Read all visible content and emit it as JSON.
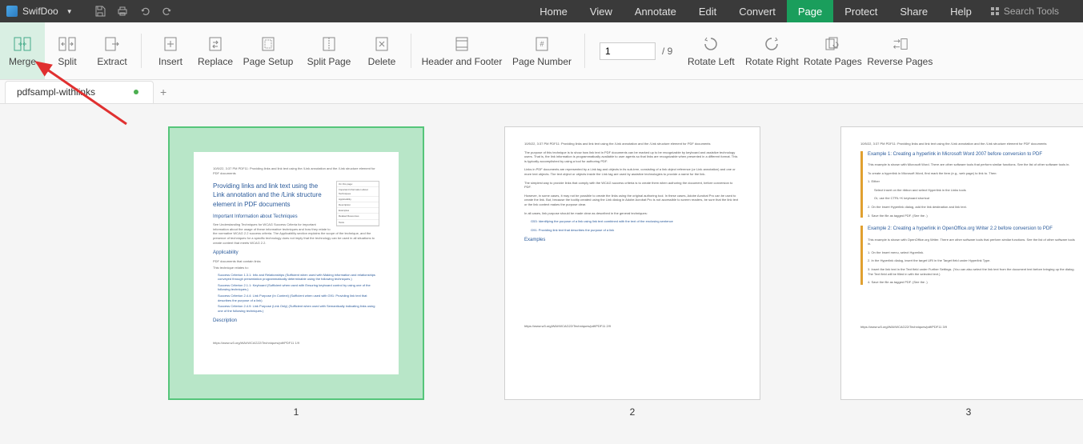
{
  "app": {
    "name": "SwifDoo"
  },
  "menu": {
    "items": [
      "Home",
      "View",
      "Annotate",
      "Edit",
      "Convert",
      "Page",
      "Protect",
      "Share",
      "Help"
    ],
    "active": "Page",
    "search_placeholder": "Search Tools"
  },
  "toolbar": {
    "merge": "Merge",
    "split": "Split",
    "extract": "Extract",
    "insert": "Insert",
    "replace": "Replace",
    "page_setup": "Page Setup",
    "split_page": "Split Page",
    "delete": "Delete",
    "header_footer": "Header and Footer",
    "page_number": "Page Number",
    "rotate_left": "Rotate Left",
    "rotate_right": "Rotate Right",
    "rotate_pages": "Rotate Pages",
    "reverse_pages": "Reverse Pages",
    "page_input": "1",
    "page_total": "/ 9"
  },
  "tabs": {
    "tab1": "pdfsampl-withlinks"
  },
  "thumbs": {
    "p1": "1",
    "p2": "2",
    "p3": "3"
  },
  "doc1": {
    "top": "10/5/22, 3:37 PM            PDF11: Providing links and link text using the /Link annotation and the /Link structure element for PDF documents",
    "title": "Providing links and link text using the Link annotation and the /Link structure element in PDF documents",
    "side1": "On this page:",
    "side2": "Important Information about Techniques",
    "side3": "Applicability",
    "side4": "Description",
    "side5": "Examples",
    "side6": "Related Resources",
    "side7": "Tests",
    "h1": "Important Information about Techniques",
    "p1": "See Understanding Techniques for WCAG Success Criteria for important information about the usage of these informative techniques and how they relate to the normative WCAG 2.2 success criteria. The Applicability section explains the scope of the technique, and the presence of techniques for a specific technology does not imply that the technology can be used in all situations to create content that meets WCAG 2.2.",
    "h2": "Applicability",
    "p2": "PDF documents that contain links",
    "p3": "This technique relates to:",
    "li1": "Success Criterion 1.3.1: Info and Relationships (Sufficient when used with Making information and relationships conveyed through presentation programmatically determinable using the following techniques.)",
    "li2": "Success Criterion 2.1.1: Keyboard (Sufficient when used with Ensuring keyboard control by using one of the following techniques.)",
    "li3": "Success Criterion 2.4.4: Link Purpose (In Context) (Sufficient when used with G91: Providing link text that describes the purpose of a link)",
    "li4": "Success Criterion 2.4.9: Link Purpose (Link Only) (Sufficient when used with Semantically indicating links using one of the following techniques.)",
    "h3": "Description",
    "foot": "https://www.w3.org/WAI/WCAG22/Techniques/pdf/PDF11                                                                                                                                       1/9"
  },
  "doc2": {
    "top": "10/5/22, 3:37 PM            PDF11: Providing links and link text using the /Link annotation and the /Link structure element for PDF documents",
    "p1": "The purpose of this technique is to show how link text in PDF documents can be marked up to be recognizable by keyboard and assistive technology users. That is, the link information is programmatically available to user agents so that links are recognizable when presented in a different format. This is typically accomplished by using a tool for authoring PDF.",
    "p2": "Links in PDF documents are represented by a Link tag and objects in its sub-tree, consisting of a link object reference (or Link annotation) and one or more text objects. The text object or objects inside the Link tag are used by assistive technologies to provide a name for the link.",
    "p3": "The simplest way to provide links that comply with the WCAG success criteria is to create them when authoring the document, before conversion to PDF.",
    "p4": "However, in some cases, it may not be possible to create the links using the original authoring tool. In these cases, Adobe Acrobat Pro can be used to create the link. But, because the tooltip created using the Link dialog in Adobe Acrobat Pro is not accessible to screen readers, be sure that the link text or the link context makes the purpose clear.",
    "p5": "In all cases, link purpose should be made clear as described in the general techniques:",
    "li1": "G53: Identifying the purpose of a link using link text combined with the text of the enclosing sentence",
    "li2": "G91: Providing link text that describes the purpose of a link",
    "h1": "Examples",
    "foot": "https://www.w3.org/WAI/WCAG22/Techniques/pdf/PDF11                                                                                                                                       2/9"
  },
  "doc3": {
    "top": "10/5/22, 3:37 PM            PDF11: Providing links and link text using the /Link annotation and the /Link structure element for PDF documents",
    "h1": "Example 1: Creating a hyperlink in Microsoft Word 2007 before conversion to PDF",
    "p1": "This example is shown with Microsoft Word. There are other software tools that perform similar functions. See the list of other software tools in.",
    "p2": "To create a hyperlink in Microsoft Word, first mark the item (e.g., web page) to link to. Then:",
    "li1": "1. Either",
    "li1a": "Select Insert on the ribbon and select Hyperlink in the Links tools",
    "li1b": "Or, use the CTRL+K keyboard shortcut",
    "li2": "2. On the Insert Hyperlink dialog, add the link destination and link text.",
    "li3": "3. Save the file as tagged PDF. (See the .)",
    "h2": "Example 2: Creating a hyperlink in OpenOffice.org Writer 2.2 before conversion to PDF",
    "p3": "This example is shown with OpenOffice.org Writer. There are other software tools that perform similar functions. See the list of other software tools in.",
    "li4": "1. On the Insert menu, select Hyperlink.",
    "li5": "2. In the Hyperlink dialog, insert the target URI in the Target field under Hyperlink Type.",
    "li6": "3. Insert the link text in the Text field under Further Settings. (You can also select the link text from the document text before bringing up the dialog. The Text field will be filled in with the selected text.)",
    "li7": "4. Save the file as tagged PDF. (See the .)",
    "foot": "https://www.w3.org/WAI/WCAG22/Techniques/pdf/PDF11                                                                                                                                       3/9"
  }
}
